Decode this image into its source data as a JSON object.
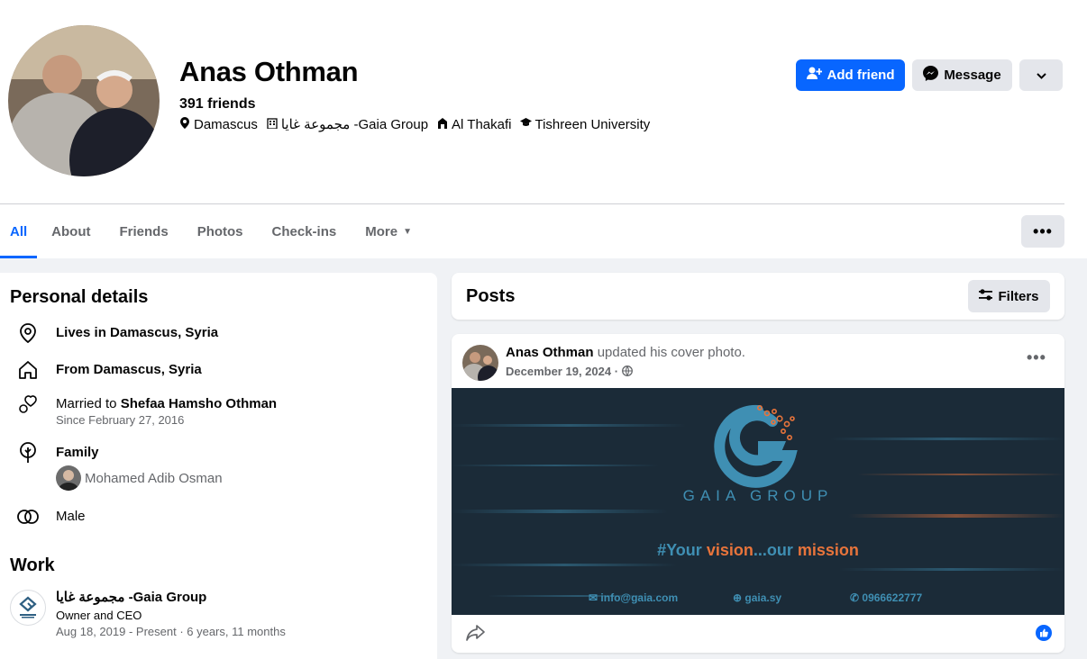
{
  "profile": {
    "name": "Anas Othman",
    "friends": "391 friends",
    "meta": {
      "city": "Damascus",
      "company": "مجموعة غايا -Gaia Group",
      "school": "Al Thakafi",
      "university": "Tishreen University"
    },
    "add_friend_label": "Add friend",
    "message_label": "Message"
  },
  "tabs": [
    {
      "label": "All"
    },
    {
      "label": "About"
    },
    {
      "label": "Friends"
    },
    {
      "label": "Photos"
    },
    {
      "label": "Check-ins"
    },
    {
      "label": "More"
    }
  ],
  "personal": {
    "title": "Personal details",
    "lives": "Lives in Damascus, Syria",
    "from": "From Damascus, Syria",
    "married_prefix": "Married to",
    "spouse": "Shefaa Hamsho Othman",
    "married_since": "Since February 27, 2016",
    "family_label": "Family",
    "family_member": "Mohamed Adib Osman",
    "gender": "Male"
  },
  "work": {
    "title": "Work",
    "company": "مجموعة غايا -Gaia Group",
    "role": "Owner and CEO",
    "dates": "Aug 18, 2019 - Present · 6 years, 11 months"
  },
  "posts": {
    "title": "Posts",
    "filters_label": "Filters"
  },
  "post": {
    "author": "Anas Othman",
    "action": "updated his cover photo.",
    "date": "December 19, 2024 ·",
    "cover": {
      "brand": "GAIA GROUP",
      "slogan_a": "#Your ",
      "slogan_b": "vision",
      "slogan_c": "...our ",
      "slogan_d": "mission",
      "email": "info@gaia.com",
      "site": "gaia.sy",
      "phone": "0966622777"
    }
  },
  "colors": {
    "accent": "#0866ff",
    "muted": "#65676b",
    "bg": "#f0f2f5",
    "cover_bg": "#1b2b38",
    "cover_orange": "#e8743b",
    "cover_blue": "#3f8fb3"
  }
}
